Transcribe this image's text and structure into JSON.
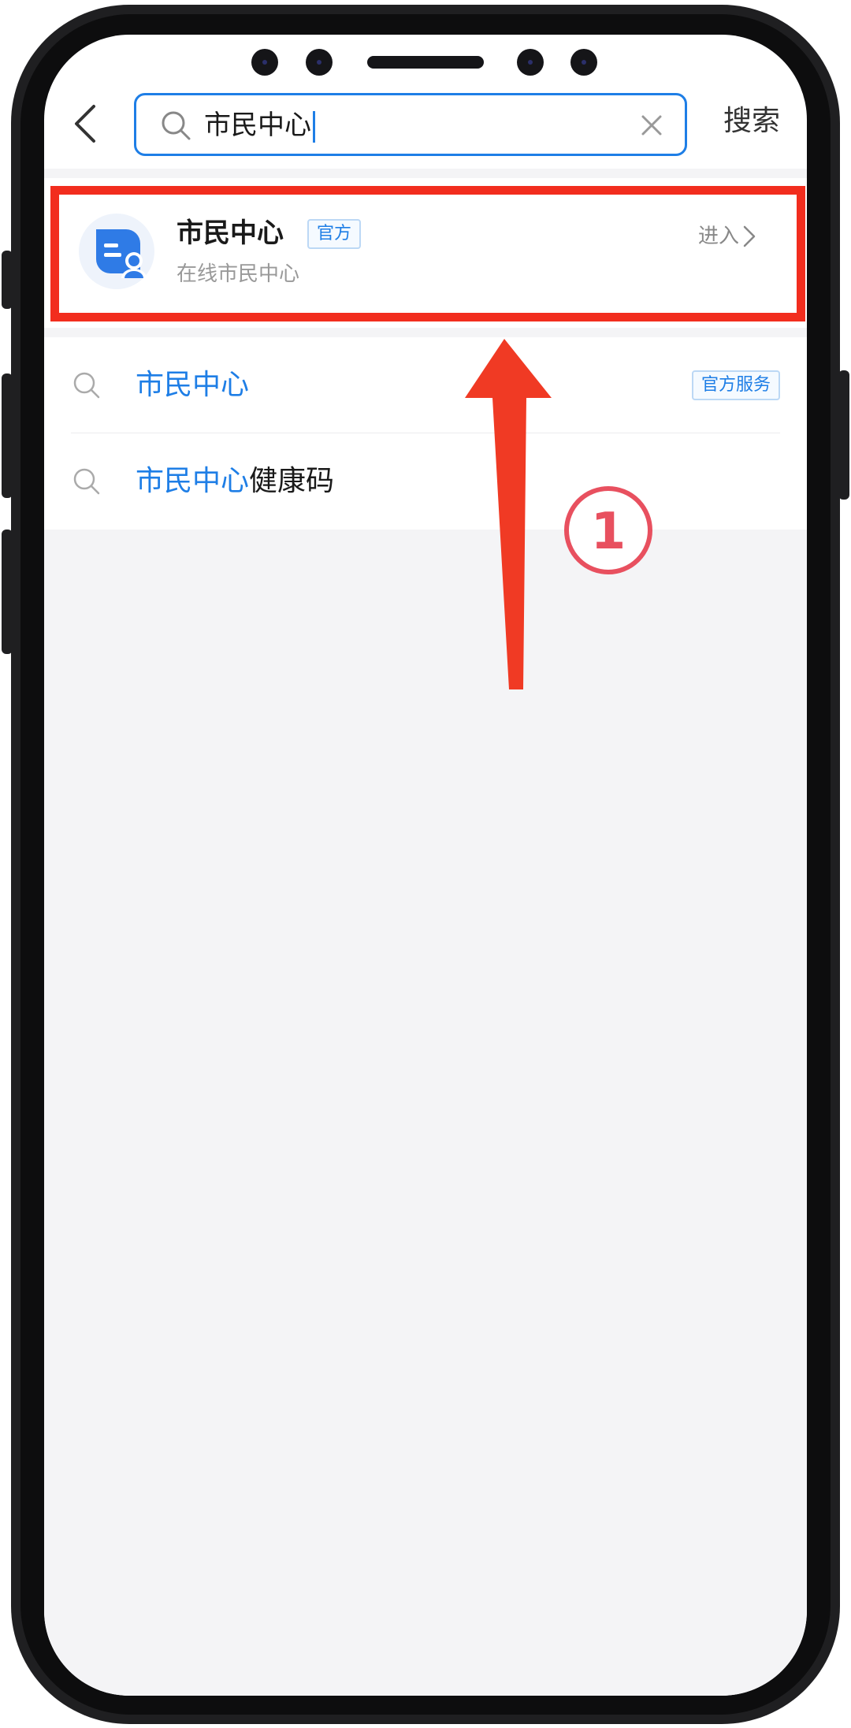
{
  "search": {
    "query": "市民中心",
    "action_label": "搜索"
  },
  "result_card": {
    "title": "市民中心",
    "badge": "官方",
    "subtitle": "在线市民中心",
    "enter_label": "进入"
  },
  "suggestions": [
    {
      "highlight": "市民中心",
      "rest": "",
      "tag": "官方服务"
    },
    {
      "highlight": "市民中心",
      "rest": "健康码",
      "tag": ""
    }
  ],
  "annotation": {
    "step_number": "①"
  },
  "colors": {
    "accent_blue": "#1e7ee6",
    "highlight_red": "#f22d1e",
    "background_gray": "#f4f4f6"
  },
  "icons": {
    "back": "chevron-left-icon",
    "search": "search-icon",
    "clear": "close-icon",
    "enter": "chevron-right-icon",
    "service": "citizen-center-app-icon"
  }
}
